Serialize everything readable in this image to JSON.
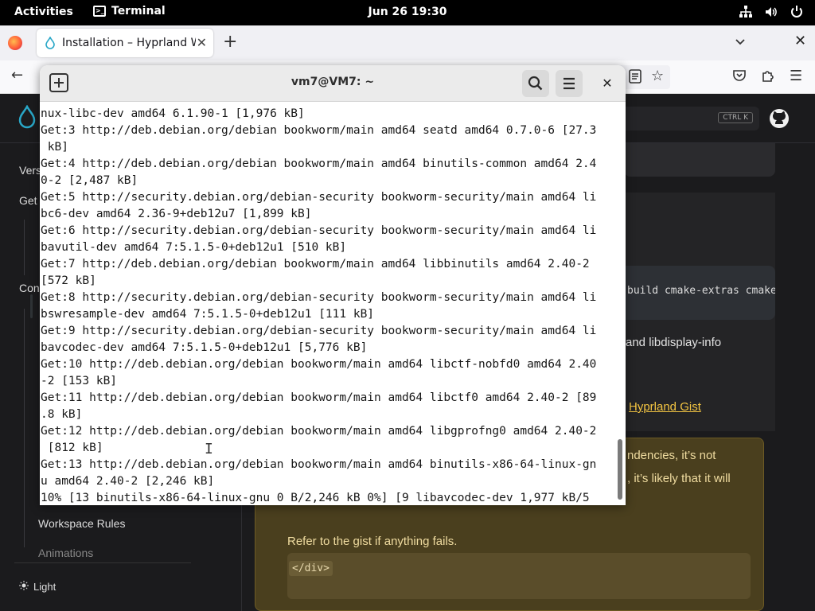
{
  "topbar": {
    "activities": "Activities",
    "app_name": "Terminal",
    "clock": "Jun 26  19:30"
  },
  "browser": {
    "tab_title": "Installation – Hyprland W",
    "icons": [
      "firefox-icon",
      "back-icon",
      "reader-view-icon",
      "bookmark-star-icon",
      "pocket-icon",
      "extensions-icon",
      "menu-icon"
    ]
  },
  "wiki": {
    "search_shortcut": "CTRL K",
    "sidebar": {
      "ver_fragment": "Vers",
      "get_fragment": "Get",
      "con_fragment": "Con",
      "workspace_rules": "Workspace Rules",
      "animations": "Animations",
      "light": "Light"
    },
    "code_fragment": "build cmake-extras cmake",
    "para_fragment": "and libdisplay-info",
    "gist_link": "Hyprland Gist",
    "warning_line1": "ndencies, it’s not",
    "warning_line2": ", it’s likely that it will",
    "warning_text": "Refer to the gist if anything fails.",
    "warning_code": "</div>"
  },
  "terminal": {
    "title": "vm7@VM7: ~",
    "lines": [
      "nux-libc-dev amd64 6.1.90-1 [1,976 kB]",
      "Get:3 http://deb.debian.org/debian bookworm/main amd64 seatd amd64 0.7.0-6 [27.3",
      " kB]",
      "Get:4 http://deb.debian.org/debian bookworm/main amd64 binutils-common amd64 2.4",
      "0-2 [2,487 kB]",
      "Get:5 http://security.debian.org/debian-security bookworm-security/main amd64 li",
      "bc6-dev amd64 2.36-9+deb12u7 [1,899 kB]",
      "Get:6 http://security.debian.org/debian-security bookworm-security/main amd64 li",
      "bavutil-dev amd64 7:5.1.5-0+deb12u1 [510 kB]",
      "Get:7 http://deb.debian.org/debian bookworm/main amd64 libbinutils amd64 2.40-2",
      "[572 kB]",
      "Get:8 http://security.debian.org/debian-security bookworm-security/main amd64 li",
      "bswresample-dev amd64 7:5.1.5-0+deb12u1 [111 kB]",
      "Get:9 http://security.debian.org/debian-security bookworm-security/main amd64 li",
      "bavcodec-dev amd64 7:5.1.5-0+deb12u1 [5,776 kB]",
      "Get:10 http://deb.debian.org/debian bookworm/main amd64 libctf-nobfd0 amd64 2.40",
      "-2 [153 kB]",
      "Get:11 http://deb.debian.org/debian bookworm/main amd64 libctf0 amd64 2.40-2 [89",
      ".8 kB]",
      "Get:12 http://deb.debian.org/debian bookworm/main amd64 libgprofng0 amd64 2.40-2",
      " [812 kB]",
      "Get:13 http://deb.debian.org/debian bookworm/main amd64 binutils-x86-64-linux-gn",
      "u amd64 2.40-2 [2,246 kB]",
      "10% [13 binutils-x86-64-linux-gnu 0 B/2,246 kB 0%] [9 libavcodec-dev 1,977 kB/5"
    ]
  }
}
